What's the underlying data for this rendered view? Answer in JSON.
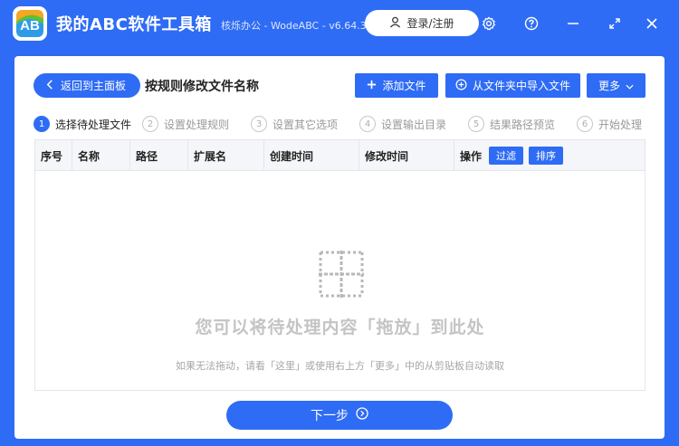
{
  "app": {
    "title": "我的ABC软件工具箱",
    "subtitle": "核烁办公 - WodeABC - v6.64.3",
    "logo_text": "AB",
    "login_label": "登录/注册",
    "icons": [
      "settings-icon",
      "help-icon",
      "minimize-icon",
      "maximize-icon",
      "close-icon"
    ]
  },
  "toolbar": {
    "back_label": "返回到主面板",
    "page_title": "按规则修改文件名称",
    "add_file_label": "添加文件",
    "import_folder_label": "从文件夹中导入文件",
    "more_label": "更多"
  },
  "steps": [
    {
      "num": "1",
      "label": "选择待处理文件",
      "active": true
    },
    {
      "num": "2",
      "label": "设置处理规则",
      "active": false
    },
    {
      "num": "3",
      "label": "设置其它选项",
      "active": false
    },
    {
      "num": "4",
      "label": "设置输出目录",
      "active": false
    },
    {
      "num": "5",
      "label": "结果路径预览",
      "active": false
    },
    {
      "num": "6",
      "label": "开始处理",
      "active": false
    }
  ],
  "table": {
    "headers": [
      "序号",
      "名称",
      "路径",
      "扩展名",
      "创建时间",
      "修改时间",
      "操作"
    ],
    "filter_label": "过滤",
    "sort_label": "排序",
    "rows": []
  },
  "drop_zone": {
    "main_text": "您可以将待处理内容「拖放」到此处",
    "hint_text": "如果无法拖动，请看「这里」或使用右上方「更多」中的从剪贴板自动读取"
  },
  "footer": {
    "next_label": "下一步"
  },
  "colors": {
    "accent": "#2f6cf5",
    "logo_orange": "#f5a623",
    "logo_green": "#5bc236",
    "logo_blue": "#2f9be8"
  }
}
